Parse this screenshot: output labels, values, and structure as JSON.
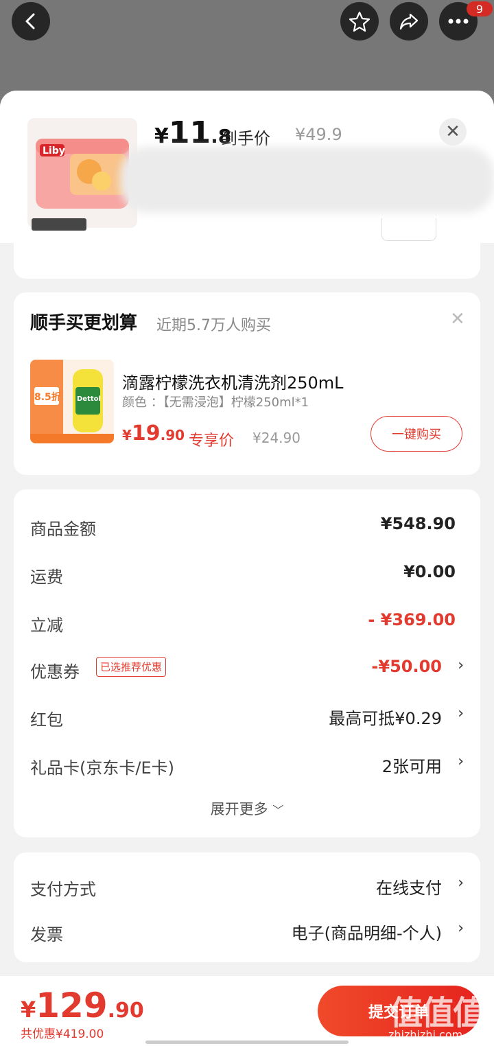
{
  "topbar": {
    "badge": "9"
  },
  "product": {
    "price_symbol": "¥",
    "price_int": "11",
    "price_dec": ".8",
    "hand_label": "到手价",
    "orig_price": "¥49.9",
    "brand_logo": "Liby"
  },
  "recommend": {
    "title": "顺手买更划算",
    "subtitle": "近期5.7万人购买",
    "item": {
      "name": "滴露柠檬洗衣机清洗剂250mL",
      "color": "颜色 ：【无需浸泡】柠檬250ml*1",
      "price_symbol": "¥",
      "price_int": "19",
      "price_dec": ".90",
      "exclusive_label": "专享价",
      "orig_price": "¥24.90",
      "buy_label": "一键购买",
      "img_discount": "8.5折",
      "img_brand": "Dettol"
    }
  },
  "summary": {
    "rows": [
      {
        "label": "商品金额",
        "value": "¥548.90"
      },
      {
        "label": "运费",
        "value": "¥0.00"
      },
      {
        "label": "立减",
        "value": "- ¥369.00"
      },
      {
        "label": "优惠券",
        "tag": "已选推荐优惠",
        "value": "-¥50.00"
      },
      {
        "label": "红包",
        "value": "最高可抵¥0.29"
      },
      {
        "label": "礼品卡(京东卡/E卡)",
        "value": "2张可用"
      }
    ],
    "expand_label": "展开更多"
  },
  "payment": {
    "rows": [
      {
        "label": "支付方式",
        "value": "在线支付"
      },
      {
        "label": "发票",
        "value": "电子(商品明细-个人)"
      }
    ]
  },
  "bottom": {
    "price_symbol": "¥",
    "price_int": "129",
    "price_dec": ".90",
    "save_text": "共优惠¥419.00",
    "submit_label": "提交订单"
  },
  "watermark": {
    "logo": "值值值",
    "site": "zhizhizhi.com"
  },
  "colors": {
    "accent": "#e23a2f"
  }
}
